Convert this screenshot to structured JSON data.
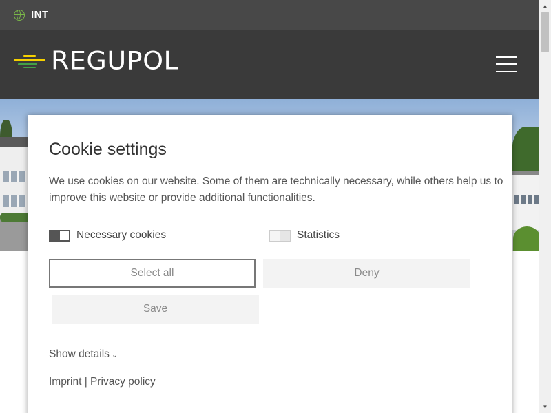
{
  "topbar": {
    "language": "INT",
    "icon": "globe-icon"
  },
  "header": {
    "logo_text": "REGUPOL",
    "menu_icon": "hamburger-icon"
  },
  "colors": {
    "header_bg": "#3a3a3a",
    "topbar_bg": "#484848",
    "logo_yellow": "#f5d000",
    "logo_green": "#43a047",
    "globe_green": "#7ab648"
  },
  "cookie": {
    "title": "Cookie settings",
    "text": "We use cookies on our website. Some of them are technically necessary, while others help us to improve this website or provide additional functionalities.",
    "options": [
      {
        "label": "Necessary cookies",
        "enabled": true
      },
      {
        "label": "Statistics",
        "enabled": false
      }
    ],
    "buttons": {
      "select_all": "Select all",
      "deny": "Deny",
      "save": "Save"
    },
    "details": {
      "label": "Show details",
      "icon": "chevron-down-icon",
      "glyph": "⌄"
    },
    "links": {
      "imprint": "Imprint",
      "separator": "|",
      "privacy": "Privacy policy"
    }
  },
  "scrollbar": {
    "up_glyph": "▲",
    "down_glyph": "▼"
  }
}
